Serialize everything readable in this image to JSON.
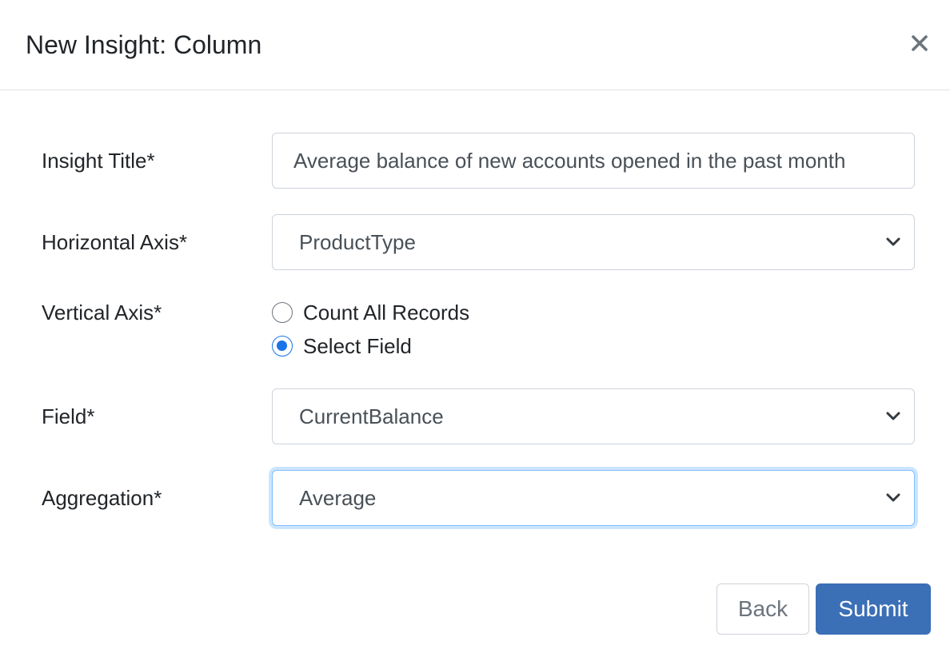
{
  "modal": {
    "title": "New Insight: Column",
    "close_icon": "close-icon"
  },
  "form": {
    "insight_title": {
      "label": "Insight Title*",
      "value": "Average balance of new accounts opened in the past month"
    },
    "horizontal_axis": {
      "label": "Horizontal Axis*",
      "selected": "ProductType"
    },
    "vertical_axis": {
      "label": "Vertical Axis*",
      "options": [
        {
          "label": "Count All Records",
          "checked": false
        },
        {
          "label": "Select Field",
          "checked": true
        }
      ]
    },
    "field": {
      "label": "Field*",
      "selected": "CurrentBalance"
    },
    "aggregation": {
      "label": "Aggregation*",
      "selected": "Average",
      "focused": true
    }
  },
  "footer": {
    "back_label": "Back",
    "submit_label": "Submit"
  },
  "colors": {
    "primary": "#3b6fb6",
    "radio_checked": "#1a73e8",
    "focus_ring": "#80bdff",
    "border": "#ced4da"
  }
}
